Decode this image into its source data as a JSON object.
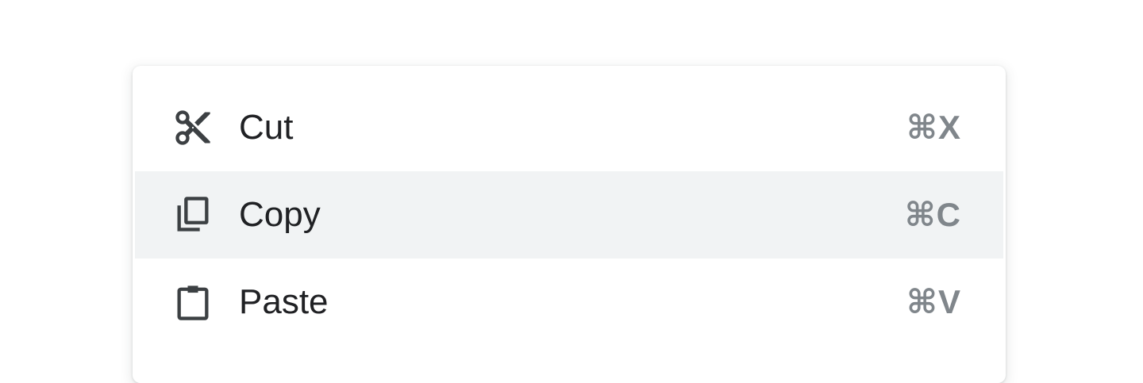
{
  "menu": {
    "items": [
      {
        "label": "Cut",
        "shortcut": "⌘X",
        "icon": "scissors-icon",
        "highlighted": false
      },
      {
        "label": "Copy",
        "shortcut": "⌘C",
        "icon": "copy-icon",
        "highlighted": true
      },
      {
        "label": "Paste",
        "shortcut": "⌘V",
        "icon": "clipboard-icon",
        "highlighted": false
      }
    ]
  },
  "colors": {
    "text": "#202124",
    "shortcut": "#80868b",
    "highlight_bg": "#f1f3f4",
    "icon": "#3c4043"
  }
}
